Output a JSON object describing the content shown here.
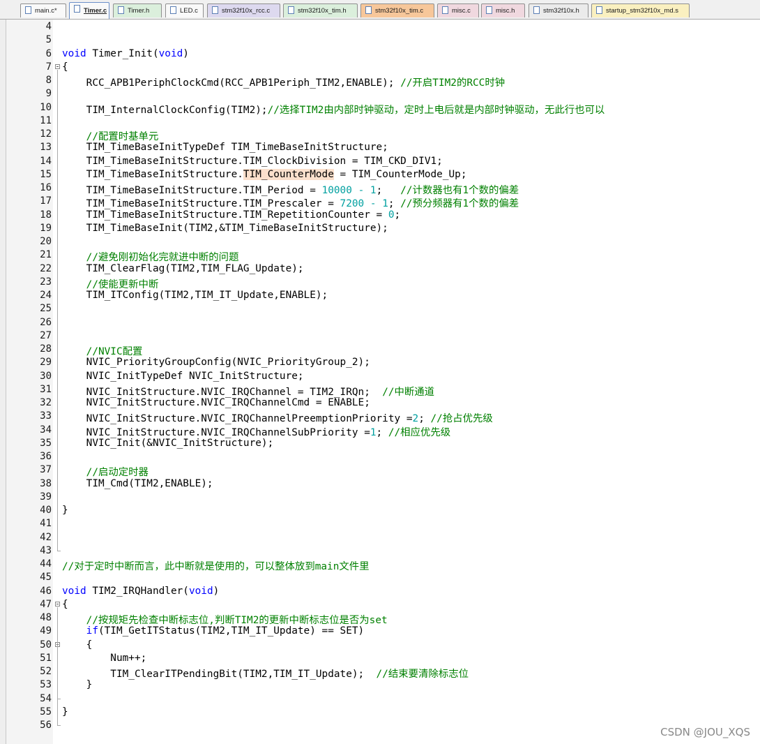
{
  "tabs": [
    {
      "label": "main.c*",
      "color": "white",
      "active": false
    },
    {
      "label": "Timer.c",
      "color": "white",
      "active": true
    },
    {
      "label": "Timer.h",
      "color": "green",
      "active": false
    },
    {
      "label": "LED.c",
      "color": "white",
      "active": false
    },
    {
      "label": "stm32f10x_rcc.c",
      "color": "lav",
      "active": false
    },
    {
      "label": "stm32f10x_tim.h",
      "color": "green",
      "active": false
    },
    {
      "label": "stm32f10x_tim.c",
      "color": "orange",
      "active": false
    },
    {
      "label": "misc.c",
      "color": "pink",
      "active": false
    },
    {
      "label": "misc.h",
      "color": "pink",
      "active": false
    },
    {
      "label": "stm32f10x.h",
      "color": "grey",
      "active": false
    },
    {
      "label": "startup_stm32f10x_md.s",
      "color": "yellow",
      "active": false
    }
  ],
  "editor": {
    "lines": [
      {
        "n": "4",
        "code": ""
      },
      {
        "n": "5",
        "code": ""
      },
      {
        "n": "6",
        "code": "void Timer_Init(void)"
      },
      {
        "n": "7",
        "code": "{"
      },
      {
        "n": "8",
        "code": "    RCC_APB1PeriphClockCmd(RCC_APB1Periph_TIM2,ENABLE); //开启TIM2的RCC时钟"
      },
      {
        "n": "9",
        "code": ""
      },
      {
        "n": "10",
        "code": "    TIM_InternalClockConfig(TIM2);//选择TIM2由内部时钟驱动，定时上电后就是内部时钟驱动，无此行也可以"
      },
      {
        "n": "11",
        "code": ""
      },
      {
        "n": "12",
        "code": "    //配置时基单元"
      },
      {
        "n": "13",
        "code": "    TIM_TimeBaseInitTypeDef TIM_TimeBaseInitStructure;"
      },
      {
        "n": "14",
        "code": "    TIM_TimeBaseInitStructure.TIM_ClockDivision = TIM_CKD_DIV1;"
      },
      {
        "n": "15",
        "code": "    TIM_TimeBaseInitStructure.TIM_CounterMode = TIM_CounterMode_Up;"
      },
      {
        "n": "16",
        "code": "    TIM_TimeBaseInitStructure.TIM_Period = 10000 - 1;   //计数器也有1个数的偏差"
      },
      {
        "n": "17",
        "code": "    TIM_TimeBaseInitStructure.TIM_Prescaler = 7200 - 1; //预分频器有1个数的偏差"
      },
      {
        "n": "18",
        "code": "    TIM_TimeBaseInitStructure.TIM_RepetitionCounter = 0;"
      },
      {
        "n": "19",
        "code": "    TIM_TimeBaseInit(TIM2,&TIM_TimeBaseInitStructure);"
      },
      {
        "n": "20",
        "code": ""
      },
      {
        "n": "21",
        "code": "    //避免刚初始化完就进中断的问题"
      },
      {
        "n": "22",
        "code": "    TIM_ClearFlag(TIM2,TIM_FLAG_Update);"
      },
      {
        "n": "23",
        "code": "    //使能更新中断"
      },
      {
        "n": "24",
        "code": "    TIM_ITConfig(TIM2,TIM_IT_Update,ENABLE);"
      },
      {
        "n": "25",
        "code": ""
      },
      {
        "n": "26",
        "code": ""
      },
      {
        "n": "27",
        "code": ""
      },
      {
        "n": "28",
        "code": "    //NVIC配置"
      },
      {
        "n": "29",
        "code": "    NVIC_PriorityGroupConfig(NVIC_PriorityGroup_2);"
      },
      {
        "n": "30",
        "code": "    NVIC_InitTypeDef NVIC_InitStructure;"
      },
      {
        "n": "31",
        "code": "    NVIC_InitStructure.NVIC_IRQChannel = TIM2_IRQn;  //中断通道"
      },
      {
        "n": "32",
        "code": "    NVIC_InitStructure.NVIC_IRQChannelCmd = ENABLE;"
      },
      {
        "n": "33",
        "code": "    NVIC_InitStructure.NVIC_IRQChannelPreemptionPriority =2; //抢占优先级"
      },
      {
        "n": "34",
        "code": "    NVIC_InitStructure.NVIC_IRQChannelSubPriority =1; //相应优先级"
      },
      {
        "n": "35",
        "code": "    NVIC_Init(&NVIC_InitStructure);"
      },
      {
        "n": "36",
        "code": ""
      },
      {
        "n": "37",
        "code": "    //启动定时器"
      },
      {
        "n": "38",
        "code": "    TIM_Cmd(TIM2,ENABLE);"
      },
      {
        "n": "39",
        "code": ""
      },
      {
        "n": "40",
        "code": "}"
      },
      {
        "n": "41",
        "code": ""
      },
      {
        "n": "42",
        "code": ""
      },
      {
        "n": "43",
        "code": ""
      },
      {
        "n": "44",
        "code": "//对于定时中断而言，此中断就是使用的，可以整体放到main文件里"
      },
      {
        "n": "45",
        "code": ""
      },
      {
        "n": "46",
        "code": "void TIM2_IRQHandler(void)"
      },
      {
        "n": "47",
        "code": "{"
      },
      {
        "n": "48",
        "code": "    //按规矩先检查中断标志位,判断TIM2的更新中断标志位是否为set"
      },
      {
        "n": "49",
        "code": "    if(TIM_GetITStatus(TIM2,TIM_IT_Update) == SET)"
      },
      {
        "n": "50",
        "code": "    {"
      },
      {
        "n": "51",
        "code": "        Num++;"
      },
      {
        "n": "52",
        "code": "        TIM_ClearITPendingBit(TIM2,TIM_IT_Update);  //结束要清除标志位"
      },
      {
        "n": "53",
        "code": "    }"
      },
      {
        "n": "54",
        "code": ""
      },
      {
        "n": "55",
        "code": "}"
      },
      {
        "n": "56",
        "code": ""
      }
    ],
    "highlighted_token": "TIM_CounterMode"
  },
  "colors": {
    "keyword": "#0000ff",
    "comment": "#008000",
    "number": "#00a0a0",
    "highlight": "#fbe0cc"
  },
  "watermark": "CSDN @JOU_XQS"
}
